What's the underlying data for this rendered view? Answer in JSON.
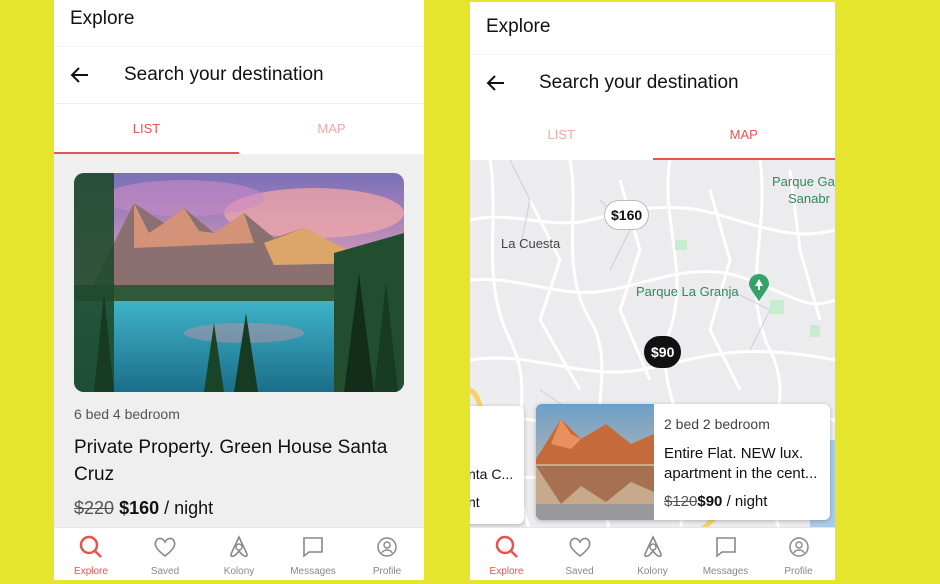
{
  "list_screen": {
    "app_title": "Explore",
    "search_title": "Search your destination",
    "tabs": [
      "LIST",
      "MAP"
    ],
    "active_tab": "LIST",
    "listing": {
      "subtitle": "6 bed 4 bedroom",
      "title": "Private Property. Green House Santa Cruz",
      "old_price": "$220",
      "price": "$160",
      "per": " / night"
    }
  },
  "map_screen": {
    "app_title": "Explore",
    "search_title": "Search your destination",
    "tabs": [
      "LIST",
      "MAP"
    ],
    "active_tab": "MAP",
    "map_labels": [
      "La Cuesta",
      "Parque La Granja",
      "Parque Ga",
      "Sanabr"
    ],
    "price_pins": [
      "$160",
      "$90"
    ],
    "partial_card": {
      "line1": "nta C...",
      "line2": "nt"
    },
    "card": {
      "subtitle": "2 bed 2 bedroom",
      "title": "Entire Flat. NEW lux. apartment in the cent...",
      "old_price": "$120",
      "price": "$90",
      "per": " / night"
    }
  },
  "bottom_nav": [
    {
      "label": "Explore",
      "icon": "search-icon",
      "active": true
    },
    {
      "label": "Saved",
      "icon": "heart-icon",
      "active": false
    },
    {
      "label": "Kolony",
      "icon": "kolony-logo-icon",
      "active": false
    },
    {
      "label": "Messages",
      "icon": "chat-icon",
      "active": false
    },
    {
      "label": "Profile",
      "icon": "profile-icon",
      "active": false
    }
  ],
  "colors": {
    "background": "#e5e52e",
    "accent": "#e8534f",
    "accent_light": "#f2a7a4",
    "map_bg": "#ececef",
    "park_green": "#2f8a5a"
  }
}
